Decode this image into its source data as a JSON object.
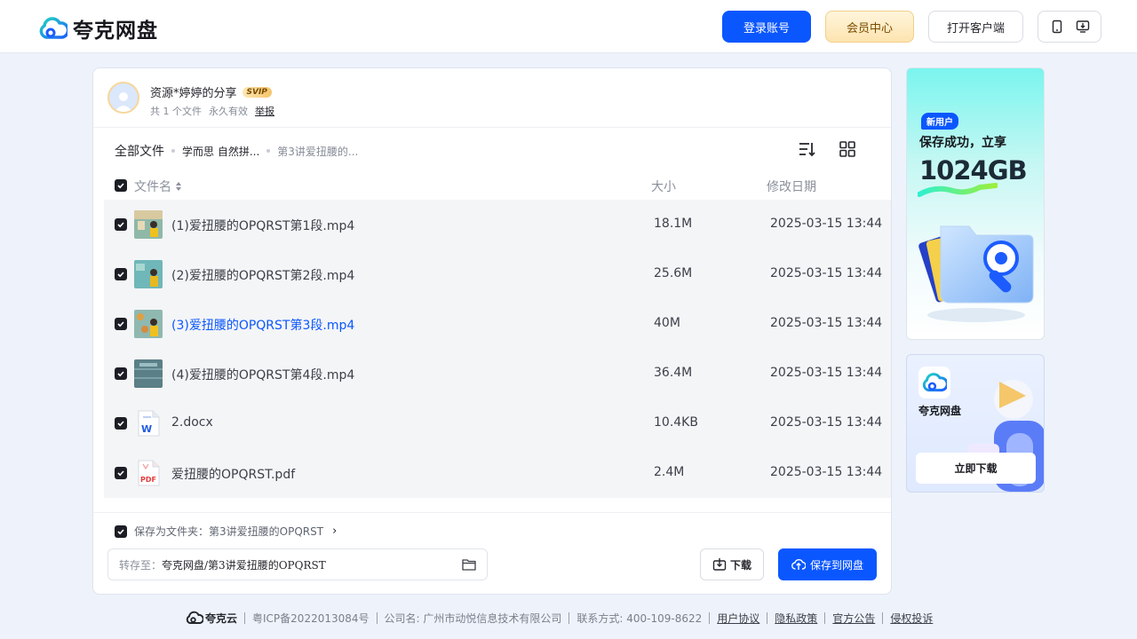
{
  "header": {
    "logo_text": "夸克网盘",
    "login_label": "登录账号",
    "vip_label": "会员中心",
    "client_label": "打开客户端",
    "device_icons": [
      "phone-icon",
      "desktop-download-icon"
    ]
  },
  "sharer": {
    "name": "资源*婷婷的分享",
    "vip_badge": "SVIP",
    "file_count": "共 1 个文件",
    "validity": "永久有效",
    "report": "举报"
  },
  "breadcrumb": {
    "root": "全部文件",
    "items": [
      "学而思 自然拼...",
      "第3讲爱扭腰的..."
    ]
  },
  "columns": {
    "name": "文件名",
    "size": "大小",
    "date": "修改日期"
  },
  "files": [
    {
      "name": "(1)爱扭腰的OPQRST第1段.mp4",
      "size": "18.1M",
      "date": "2025-03-15 13:44",
      "type": "video"
    },
    {
      "name": "(2)爱扭腰的OPQRST第2段.mp4",
      "size": "25.6M",
      "date": "2025-03-15 13:44",
      "type": "video"
    },
    {
      "name": "(3)爱扭腰的OPQRST第3段.mp4",
      "size": "40M",
      "date": "2025-03-15 13:44",
      "type": "video"
    },
    {
      "name": "(4)爱扭腰的OPQRST第4段.mp4",
      "size": "36.4M",
      "date": "2025-03-15 13:44",
      "type": "video"
    },
    {
      "name": "2.docx",
      "size": "10.4KB",
      "date": "2025-03-15 13:44",
      "type": "docx"
    },
    {
      "name": "爱扭腰的OPQRST.pdf",
      "size": "2.4M",
      "date": "2025-03-15 13:44",
      "type": "pdf"
    }
  ],
  "save_as": {
    "label": "保存为文件夹：第3讲爱扭腰的OPQRST",
    "arrow": "›"
  },
  "destination": {
    "label": "转存至：",
    "path": "夸克网盘/第3讲爱扭腰的OPQRST"
  },
  "actions": {
    "download": "下载",
    "save": "保存到网盘"
  },
  "ad_new_user": {
    "badge": "新用户",
    "line1": "保存成功，立享",
    "highlight": "1024GB"
  },
  "ad_app": {
    "name": "夸克网盘",
    "button": "立即下载"
  },
  "footer": {
    "brand": "夸克云",
    "icp": "粤ICP备2022013084号",
    "company": "公司名: 广州市动悦信息技术有限公司",
    "contact": "联系方式: 400-109-8622",
    "links": [
      "用户协议",
      "隐私政策",
      "官方公告",
      "侵权投诉"
    ]
  },
  "colors": {
    "accent": "#0b57ff",
    "page_bg": "#eef3fb",
    "row_bg": "#f4f5f7"
  }
}
